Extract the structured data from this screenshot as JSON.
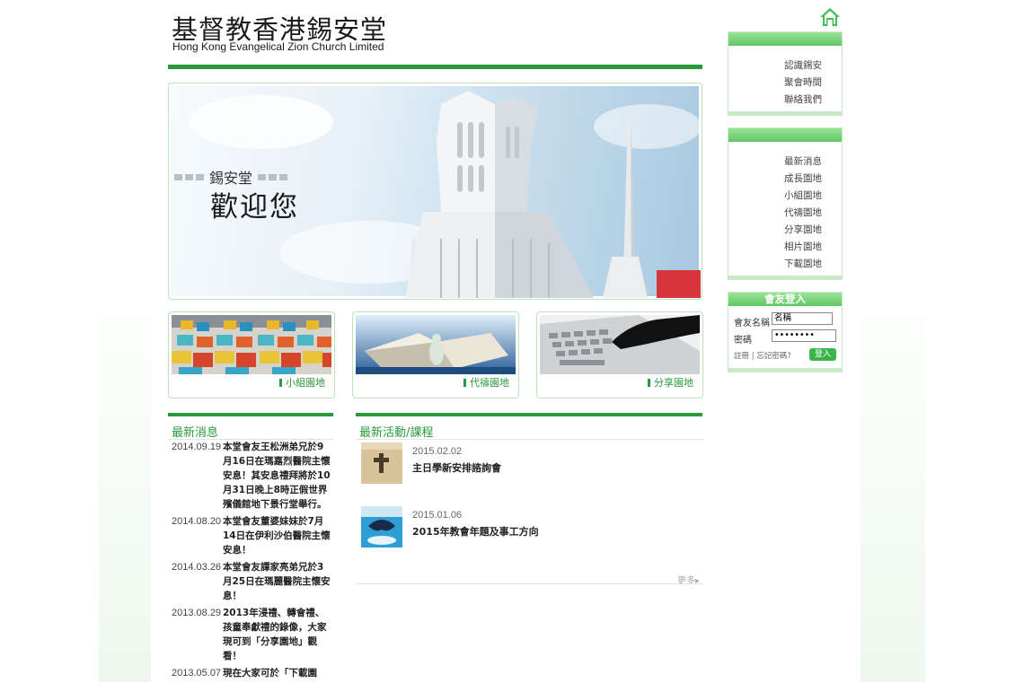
{
  "header": {
    "logo_zh": "基督教香港錫安堂",
    "logo_en": "Hong Kong Evangelical Zion Church Limited",
    "home_icon": "home-icon"
  },
  "banner": {
    "subtitle": "錫安堂",
    "title": "歡迎您"
  },
  "features": [
    {
      "label": "小組園地"
    },
    {
      "label": "代禱園地"
    },
    {
      "label": "分享園地"
    }
  ],
  "news": {
    "heading": "最新消息",
    "items": [
      {
        "date": "2014.09.19",
        "text": "本堂會友王松洲弟兄於9月16日在瑪嘉烈醫院主懷安息！其安息禮拜將於10月31日晚上8時正假世界殯儀館地下景行堂舉行。"
      },
      {
        "date": "2014.08.20",
        "text": "本堂會友董婆妹妹於7月14日在伊利沙伯醫院主懷安息！"
      },
      {
        "date": "2014.03.26",
        "text": "本堂會友譚家亮弟兄於3月25日在瑪麗醫院主懷安息！"
      },
      {
        "date": "2013.08.29",
        "text": "2013年浸禮、轉會禮、孩童奉獻禮的錄像，大家現可到「分享園地」觀看！"
      },
      {
        "date": "2013.05.07",
        "text": "現在大家可於「下載園"
      }
    ]
  },
  "activities": {
    "heading": "最新活動/課程",
    "items": [
      {
        "date": "2015.02.02",
        "title": "主日學新安排諮詢會"
      },
      {
        "date": "2015.01.06",
        "title": "2015年教會年題及事工方向"
      }
    ],
    "more": "更多▸"
  },
  "sidebar": {
    "box1": [
      "認識錫安",
      "聚會時間",
      "聯絡我們"
    ],
    "box2": [
      "最新消息",
      "成長園地",
      "小組園地",
      "代禱園地",
      "分享園地",
      "相片園地",
      "下載園地"
    ],
    "login": {
      "title": "會友登入",
      "name_label": "會友名稱",
      "name_value": "名稱",
      "password_label": "密碼",
      "password_value": "••••••••",
      "register": "註冊",
      "separator": "|",
      "forgot": "忘記密碼?",
      "button": "登入"
    }
  },
  "colors": {
    "accent": "#2a9a3c",
    "light_green": "#b8e6b8"
  }
}
